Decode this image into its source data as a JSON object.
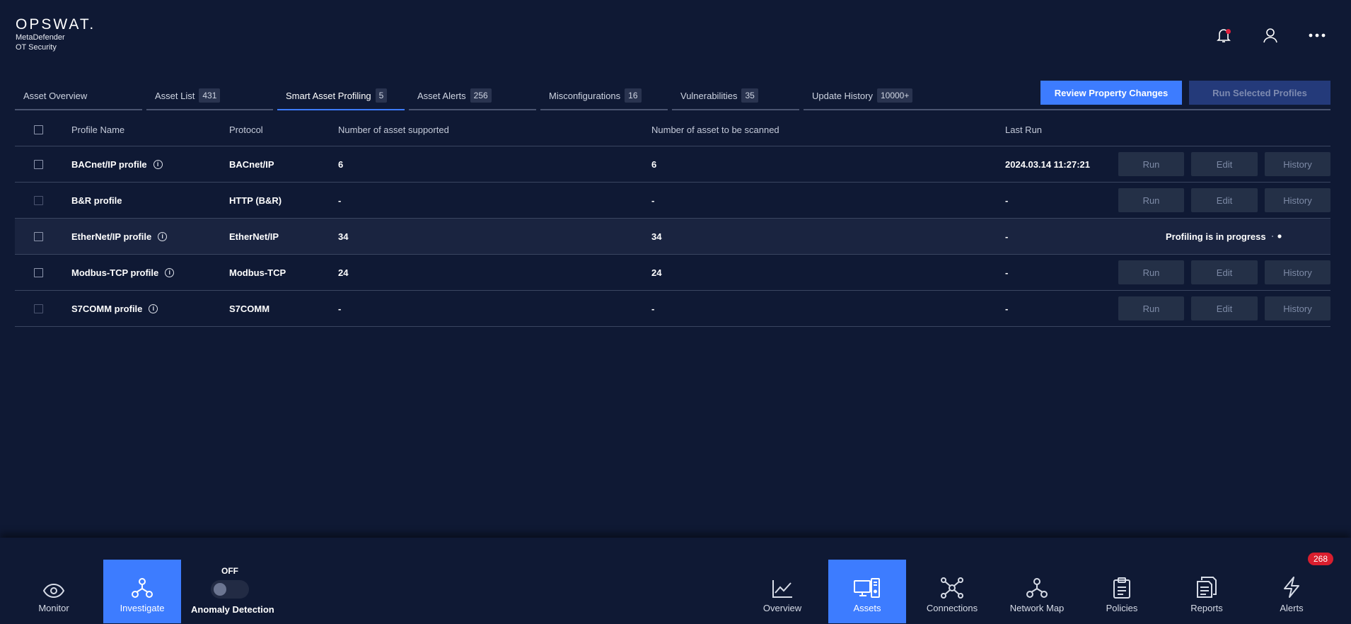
{
  "brand": {
    "name": "OPSWAT.",
    "product": "MetaDefender",
    "module": "OT Security"
  },
  "top_icons": [
    "bell-icon",
    "user-icon",
    "more-icon"
  ],
  "tabs": [
    {
      "label": "Asset Overview",
      "count": ""
    },
    {
      "label": "Asset List",
      "count": "431"
    },
    {
      "label": "Smart Asset Profiling",
      "count": "5"
    },
    {
      "label": "Asset Alerts",
      "count": "256"
    },
    {
      "label": "Misconfigurations",
      "count": "16"
    },
    {
      "label": "Vulnerabilities",
      "count": "35"
    },
    {
      "label": "Update History",
      "count": "10000+"
    }
  ],
  "actions": {
    "review": "Review Property Changes",
    "run_selected": "Run Selected Profiles"
  },
  "table": {
    "headers": {
      "name": "Profile Name",
      "protocol": "Protocol",
      "supported": "Number of asset supported",
      "scanned": "Number of asset to be scanned",
      "last_run": "Last Run"
    },
    "buttons": {
      "run": "Run",
      "edit": "Edit",
      "history": "History"
    },
    "progress_text": "Profiling is in progress",
    "rows": [
      {
        "name": "BACnet/IP profile",
        "protocol": "BACnet/IP",
        "supported": "6",
        "scanned": "6",
        "last_run": "2024.03.14 11:27:21"
      },
      {
        "name": "B&R profile",
        "protocol": "HTTP (B&R)",
        "supported": "-",
        "scanned": "-",
        "last_run": "-"
      },
      {
        "name": "EtherNet/IP profile",
        "protocol": "EtherNet/IP",
        "supported": "34",
        "scanned": "34",
        "last_run": "-"
      },
      {
        "name": "Modbus-TCP profile",
        "protocol": "Modbus-TCP",
        "supported": "24",
        "scanned": "24",
        "last_run": "-"
      },
      {
        "name": "S7COMM profile",
        "protocol": "S7COMM",
        "supported": "-",
        "scanned": "-",
        "last_run": "-"
      }
    ]
  },
  "bottom_nav": {
    "monitor": "Monitor",
    "investigate": "Investigate",
    "anomaly_state": "OFF",
    "anomaly_label": "Anomaly Detection",
    "overview": "Overview",
    "assets": "Assets",
    "connections": "Connections",
    "network_map": "Network Map",
    "policies": "Policies",
    "reports": "Reports",
    "alerts": "Alerts",
    "alerts_count": "268"
  }
}
